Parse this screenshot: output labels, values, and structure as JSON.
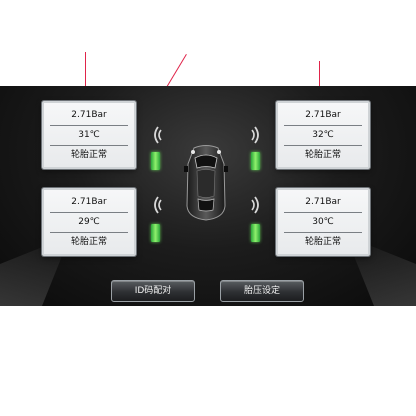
{
  "tires": {
    "front_left": {
      "pressure": "2.71Bar",
      "temperature": "31℃",
      "status": "轮胎正常"
    },
    "front_right": {
      "pressure": "2.71Bar",
      "temperature": "32℃",
      "status": "轮胎正常"
    },
    "rear_left": {
      "pressure": "2.71Bar",
      "temperature": "29℃",
      "status": "轮胎正常"
    },
    "rear_right": {
      "pressure": "2.71Bar",
      "temperature": "30℃",
      "status": "轮胎正常"
    }
  },
  "buttons": {
    "id_pairing": "ID码配对",
    "pressure_settings": "胎压设定"
  },
  "colors": {
    "callout": "#e0244a",
    "battery": "#4fd44a",
    "background": "#1c1c1c"
  },
  "icons": [
    "signal-wave-icon",
    "battery-icon",
    "car-icon"
  ]
}
